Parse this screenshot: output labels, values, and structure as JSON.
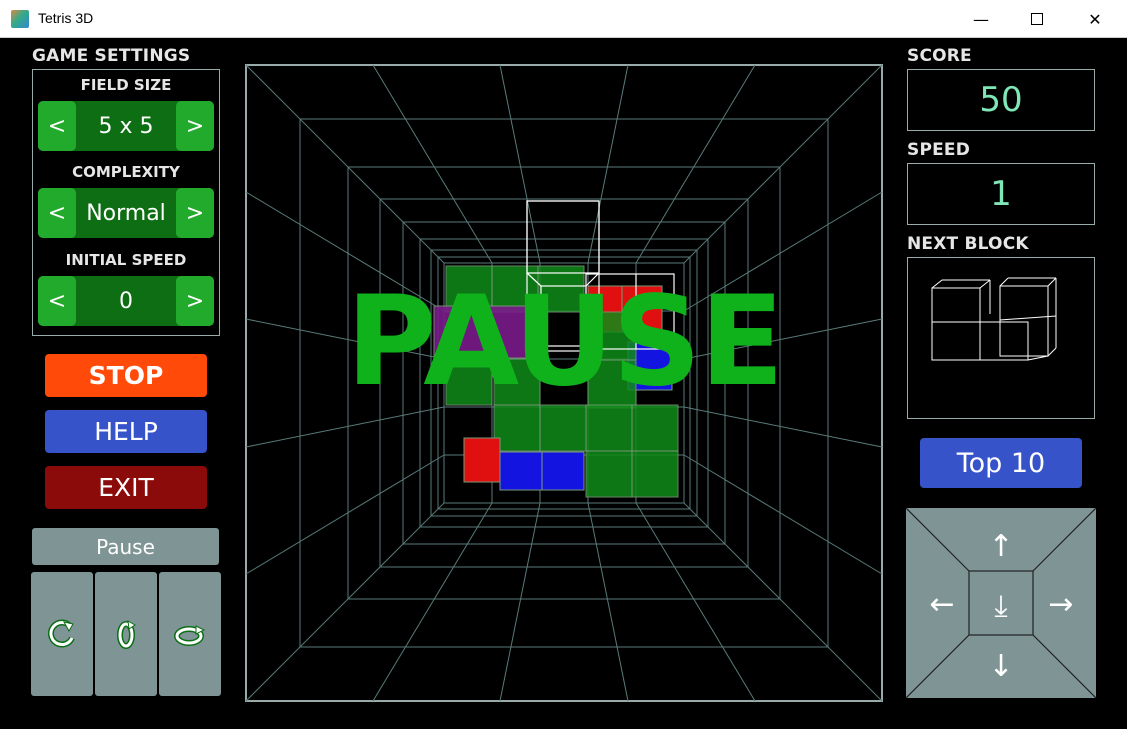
{
  "window": {
    "title": "Tetris 3D",
    "minimize_glyph": "—",
    "close_glyph": "✕"
  },
  "settings": {
    "title": "GAME SETTINGS",
    "field_size": {
      "label": "FIELD SIZE",
      "value": "5 x 5",
      "prev": "<",
      "next": ">"
    },
    "complexity": {
      "label": "COMPLEXITY",
      "value": "Normal",
      "prev": "<",
      "next": ">"
    },
    "initial_speed": {
      "label": "INITIAL SPEED",
      "value": "0",
      "prev": "<",
      "next": ">"
    }
  },
  "controls": {
    "stop": "STOP",
    "help": "HELP",
    "exit": "EXIT",
    "pause": "Pause",
    "rotate_icons": [
      "rotate-x-icon",
      "rotate-y-icon",
      "rotate-z-icon"
    ]
  },
  "game": {
    "overlay_text": "PAUSE",
    "grid_color": "#5a7a7a",
    "block_colors": {
      "green": "#0f8c18",
      "red": "#e01010",
      "blue": "#1414e0",
      "purple": "#7a1a8a"
    }
  },
  "stats": {
    "score_label": "SCORE",
    "score": "50",
    "speed_label": "SPEED",
    "speed": "1",
    "next_block_label": "NEXT BLOCK"
  },
  "actions": {
    "top10": "Top 10",
    "dpad_icons": [
      "arrow-up-icon",
      "arrow-left-icon",
      "drop-icon",
      "arrow-right-icon",
      "arrow-down-icon"
    ]
  },
  "colors": {
    "accent_green": "#22aa2c",
    "stop_orange": "#ff4a0a",
    "help_blue": "#3753c9",
    "exit_red": "#8b0a0a",
    "panel_gray": "#7f9494",
    "stat_text": "#7fe6b8"
  }
}
